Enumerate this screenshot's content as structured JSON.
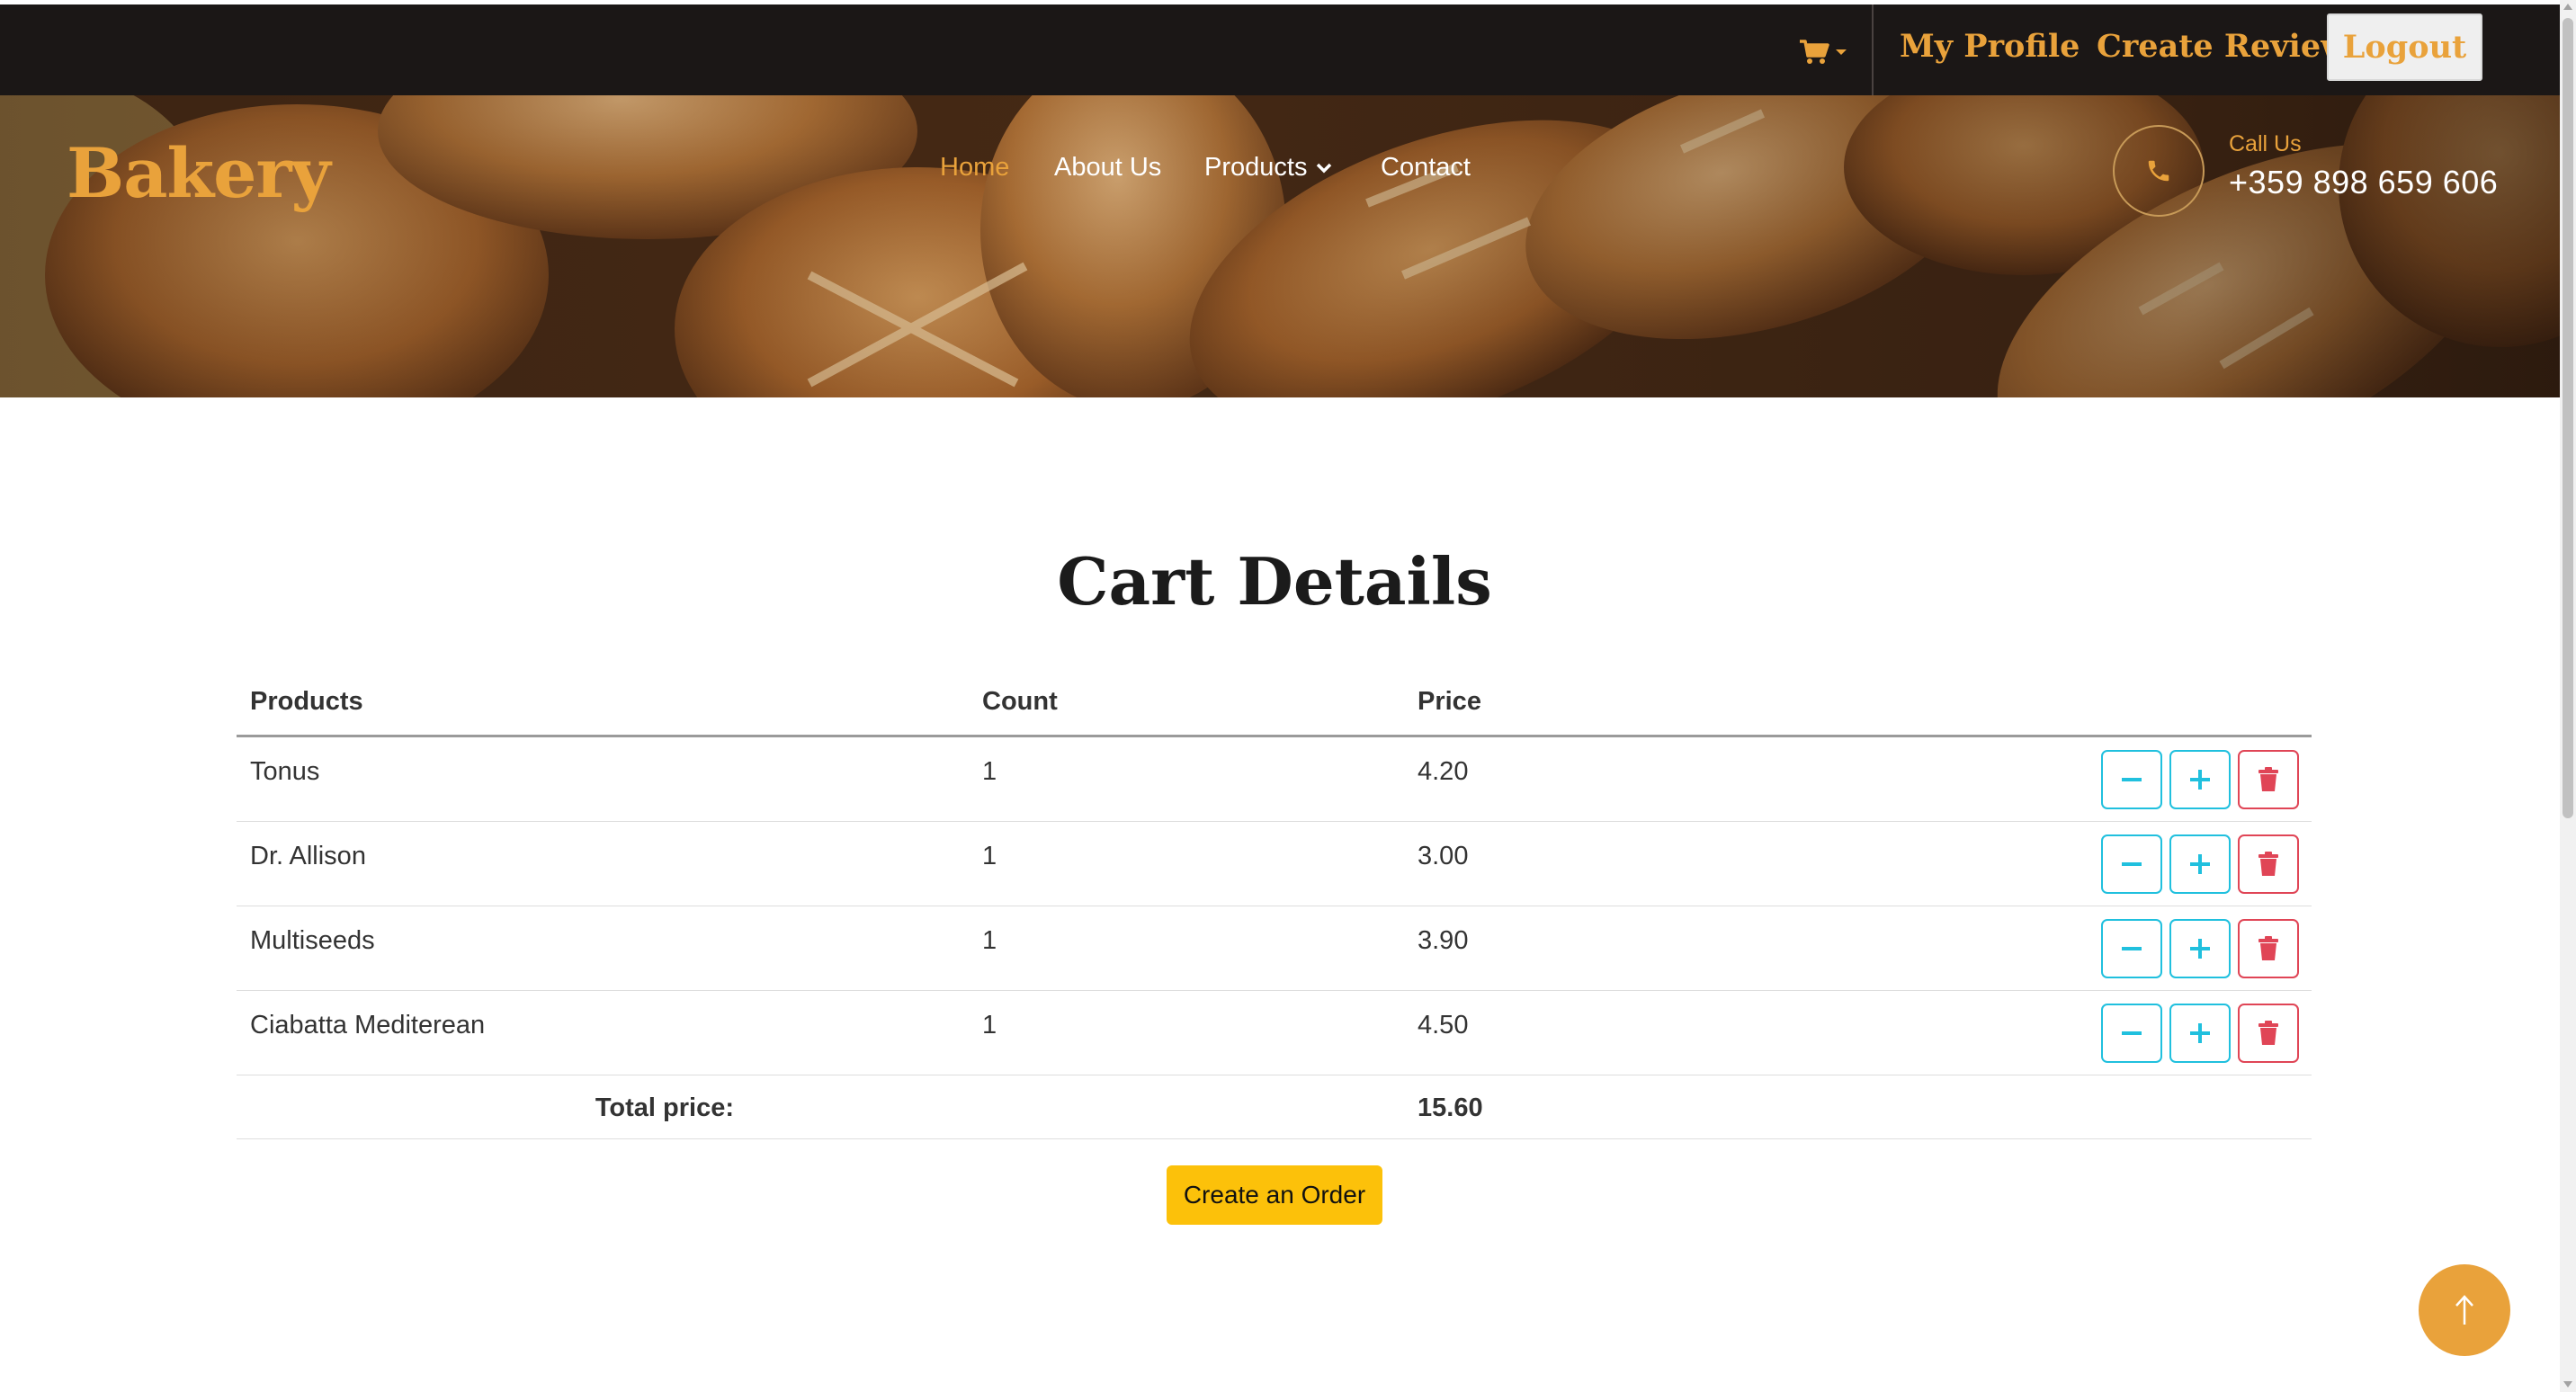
{
  "topbar": {
    "cart_icon": "shopping-cart-icon",
    "links": {
      "profile": "My Profile",
      "review": "Create Review"
    },
    "logout": "Logout"
  },
  "hero": {
    "logo": "Bakery",
    "nav": {
      "home": "Home",
      "about": "About Us",
      "products": "Products",
      "contact": "Contact"
    },
    "call_label": "Call Us",
    "phone": "+359 898 659 606"
  },
  "main": {
    "title": "Cart Details",
    "table": {
      "headers": {
        "product": "Products",
        "count": "Count",
        "price": "Price"
      },
      "rows": [
        {
          "product": "Tonus",
          "count": "1",
          "price": "4.20"
        },
        {
          "product": "Dr. Allison",
          "count": "1",
          "price": "3.00"
        },
        {
          "product": "Multiseeds",
          "count": "1",
          "price": "3.90"
        },
        {
          "product": "Ciabatta Mediterean",
          "count": "1",
          "price": "4.50"
        }
      ],
      "total_label": "Total price:",
      "total_value": "15.60"
    },
    "order_button": "Create an Order"
  },
  "colors": {
    "accent": "#e9a23b",
    "topbar_bg": "#1b1716",
    "info": "#20c0de",
    "danger": "#e04556",
    "order_button": "#fcc10a"
  }
}
